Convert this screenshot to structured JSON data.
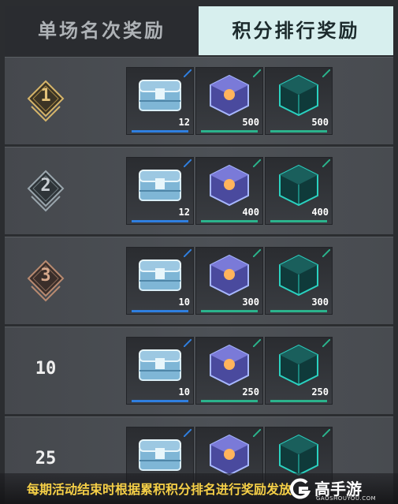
{
  "tabs": [
    {
      "label": "单场名次奖励",
      "active": false
    },
    {
      "label": "积分排行奖励",
      "active": true
    }
  ],
  "rows": [
    {
      "rank": "1",
      "badge": "gold",
      "items": [
        {
          "icon": "chest-icon",
          "qty": "12"
        },
        {
          "icon": "purple-cube-icon",
          "qty": "500"
        },
        {
          "icon": "teal-cube-icon",
          "qty": "500"
        }
      ]
    },
    {
      "rank": "2",
      "badge": "silver",
      "items": [
        {
          "icon": "chest-icon",
          "qty": "12"
        },
        {
          "icon": "purple-cube-icon",
          "qty": "400"
        },
        {
          "icon": "teal-cube-icon",
          "qty": "400"
        }
      ]
    },
    {
      "rank": "3",
      "badge": "bronze",
      "items": [
        {
          "icon": "chest-icon",
          "qty": "10"
        },
        {
          "icon": "purple-cube-icon",
          "qty": "300"
        },
        {
          "icon": "teal-cube-icon",
          "qty": "300"
        }
      ]
    },
    {
      "rank": "10",
      "badge": "none",
      "items": [
        {
          "icon": "chest-icon",
          "qty": "10"
        },
        {
          "icon": "purple-cube-icon",
          "qty": "250"
        },
        {
          "icon": "teal-cube-icon",
          "qty": "250"
        }
      ]
    },
    {
      "rank": "25",
      "badge": "none",
      "items": [
        {
          "icon": "chest-icon",
          "qty": ""
        },
        {
          "icon": "purple-cube-icon",
          "qty": ""
        },
        {
          "icon": "teal-cube-icon",
          "qty": ""
        }
      ]
    }
  ],
  "footer": {
    "text": "每期活动结束时根据累积积分排名进行奖励发放"
  },
  "watermark": {
    "title": "高手游",
    "sub": "GAOSHOUYOU.COM"
  },
  "colors": {
    "gold": "#e3c27a",
    "silver": "#c9ced3",
    "bronze": "#d7a98c",
    "active_tab": "#d7efee",
    "footer_text": "#f5cf47"
  }
}
